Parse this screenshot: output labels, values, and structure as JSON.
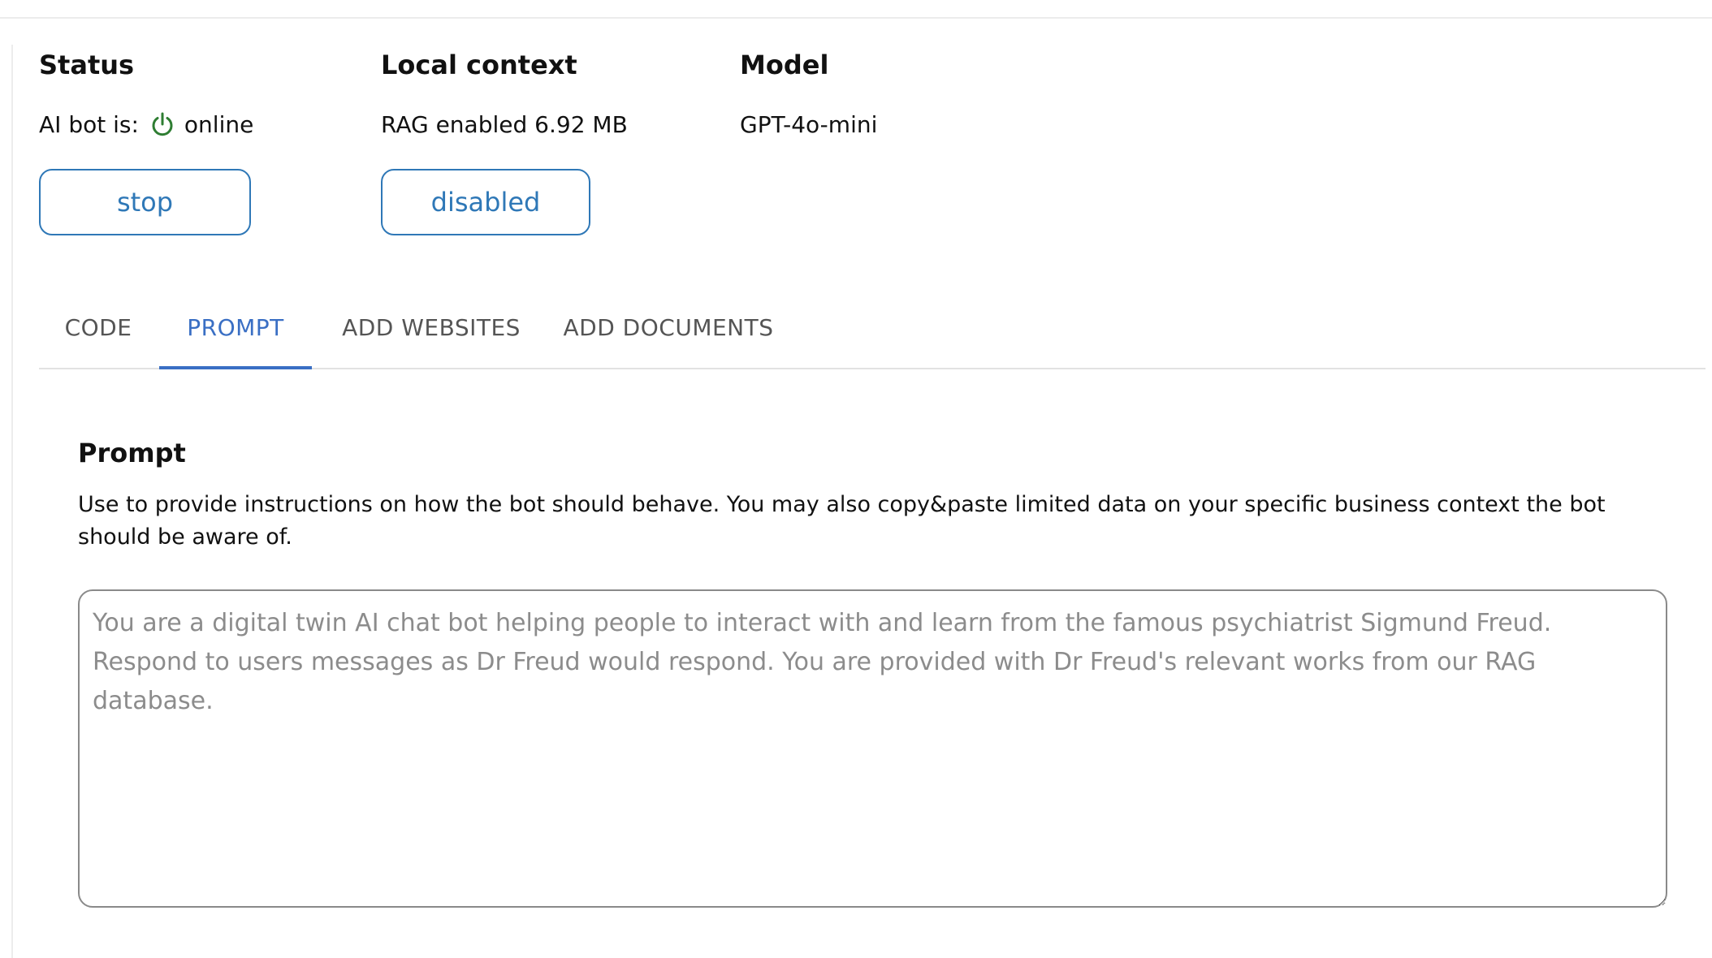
{
  "status": {
    "title": "Status",
    "label": "AI bot is:",
    "state": "online",
    "state_color": "#2e7d32",
    "icon": "power-icon",
    "button_label": "stop"
  },
  "context": {
    "title": "Local context",
    "value": "RAG enabled 6.92 MB",
    "button_label": "disabled"
  },
  "model": {
    "title": "Model",
    "value": "GPT-4o-mini"
  },
  "tabs": [
    {
      "label": "CODE",
      "active": false
    },
    {
      "label": "PROMPT",
      "active": true
    },
    {
      "label": "ADD WEBSITES",
      "active": false
    },
    {
      "label": "ADD DOCUMENTS",
      "active": false
    }
  ],
  "prompt": {
    "title": "Prompt",
    "description": "Use to provide instructions on how the bot should behave. You may also copy&paste limited data on your specific business context the bot should be aware of.",
    "placeholder": "You are a digital twin AI chat bot helping people to interact with and learn from the famous psychiatrist Sigmund Freud. Respond to users messages as Dr Freud would respond. You are provided with Dr Freud's relevant works from our RAG database.",
    "value": ""
  },
  "colors": {
    "accent": "#2f78b7",
    "tab_active": "#3a6fc4",
    "online": "#2e7d32"
  }
}
